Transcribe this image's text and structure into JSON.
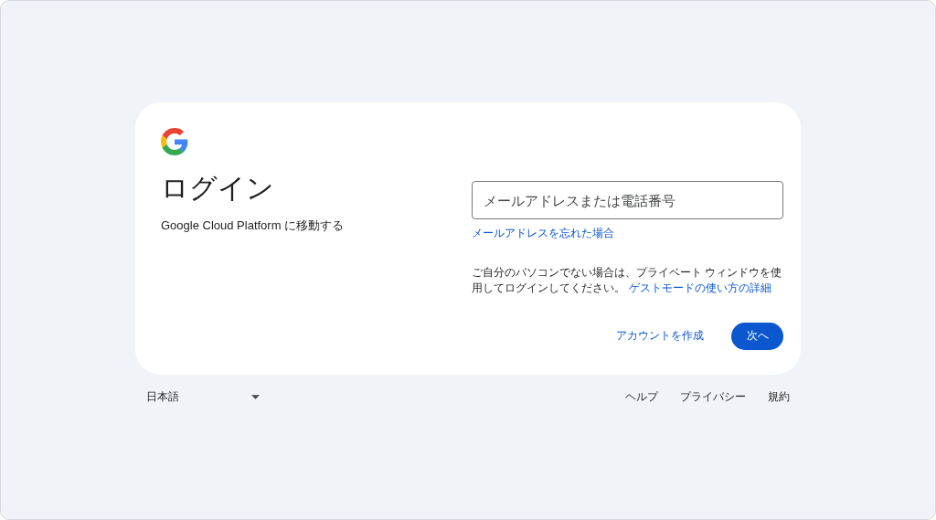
{
  "card": {
    "heading": "ログイン",
    "subtitle": "Google Cloud Platform に移動する",
    "email_field": {
      "placeholder": "メールアドレスまたは電話番号"
    },
    "forgot_link": "メールアドレスを忘れた場合",
    "note": {
      "text": "ご自分のパソコンでない場合は、プライベート ウィンドウを使用してログインしてください。",
      "link": "ゲストモードの使い方の詳細"
    },
    "create_account": "アカウントを作成",
    "next_button": "次へ"
  },
  "footer": {
    "language": "日本語",
    "links": [
      "ヘルプ",
      "プライバシー",
      "規約"
    ]
  }
}
